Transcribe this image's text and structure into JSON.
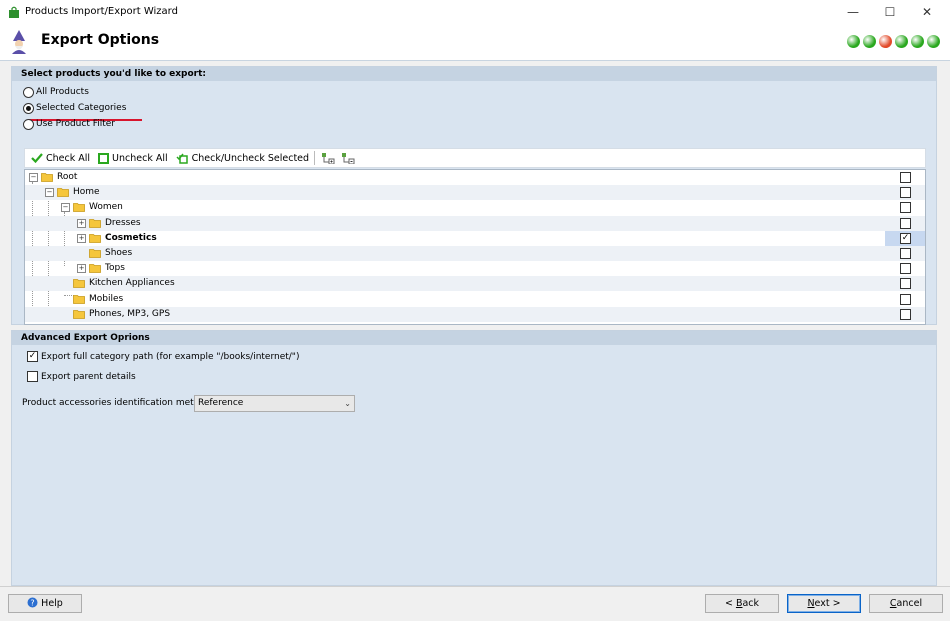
{
  "window": {
    "title": "Products Import/Export Wizard",
    "min": "—",
    "max": "☐",
    "close": "✕"
  },
  "header": {
    "title": "Export Options",
    "step_colors": [
      "#2aa81f",
      "#2aa81f",
      "#e24a2a",
      "#2aa81f",
      "#2aa81f",
      "#2aa81f"
    ]
  },
  "select_panel": {
    "title": "Select products you'd like to export:",
    "options": [
      {
        "label": "All Products",
        "selected": false
      },
      {
        "label": "Selected Categories",
        "selected": true
      },
      {
        "label": "Use Product Filter",
        "selected": false
      }
    ]
  },
  "toolbar": {
    "check_all": "Check All",
    "uncheck_all": "Uncheck All",
    "check_uncheck_selected": "Check/Uncheck Selected",
    "icons": [
      "expand-tree-icon",
      "collapse-tree-icon"
    ]
  },
  "tree": [
    {
      "label": "Root",
      "expander": "⊟",
      "checked": false
    },
    {
      "label": "Home",
      "expander": "⊟",
      "checked": false
    },
    {
      "label": "Women",
      "expander": "⊟",
      "checked": false
    },
    {
      "label": "Dresses",
      "expander": "⊞",
      "checked": false
    },
    {
      "label": "Cosmetics",
      "expander": "⊞",
      "checked": true,
      "bold": true
    },
    {
      "label": "Shoes",
      "expander": "",
      "checked": false
    },
    {
      "label": "Tops",
      "expander": "⊞",
      "checked": false
    },
    {
      "label": "Kitchen Appliances",
      "expander": "",
      "checked": false
    },
    {
      "label": "Mobiles",
      "expander": "",
      "checked": false
    },
    {
      "label": "Phones, MP3, GPS",
      "expander": "",
      "checked": false
    }
  ],
  "advanced": {
    "title": "Advanced Export Oprions",
    "full_path_label": "Export full category path (for example \"/books/internet/\")",
    "full_path_checked": true,
    "parent_details_label": "Export parent details",
    "parent_details_checked": false,
    "accessories_label": "Product accessories identification method",
    "accessories_value": "Reference"
  },
  "buttons": {
    "help": "Help",
    "back_mnemonic": "B",
    "back_rest": "ack",
    "back_prefix": "< ",
    "next_mnemonic": "N",
    "next_rest": "ext",
    "next_suffix": " >",
    "cancel_mnemonic": "C",
    "cancel_rest": "ancel"
  }
}
